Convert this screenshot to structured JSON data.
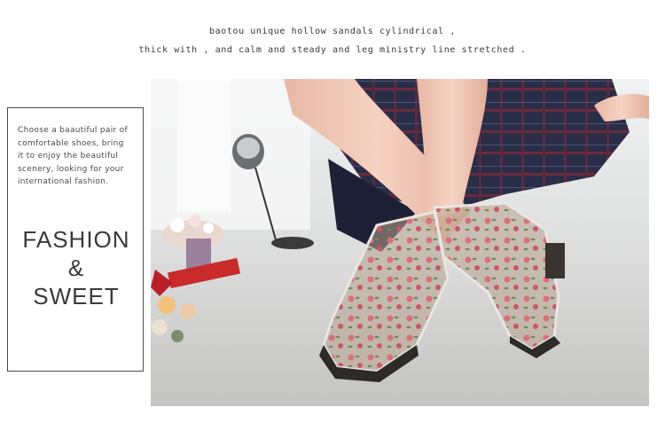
{
  "captions": {
    "line1": "baotou unique hollow sandals cylindrical ,",
    "line2": "thick with , and calm and steady and leg ministry line stretched ."
  },
  "card": {
    "description_lines": [
      "Choose a baautiful pair of",
      "comfortable shoes,  bring",
      "it to enjoy the beautiful",
      "scenery,  looking for your",
      "international fashion."
    ],
    "headline": [
      "FASHION",
      "&",
      "SWEET"
    ]
  },
  "colors": {
    "floor": "#c9c9c7",
    "wall": "#e9ebec",
    "skin": "#f2c7b4",
    "plaid": "#2c2f4a",
    "boot_clear": "#d9d4cf",
    "rose": "#d9707a",
    "sole": "#2e2a28"
  }
}
